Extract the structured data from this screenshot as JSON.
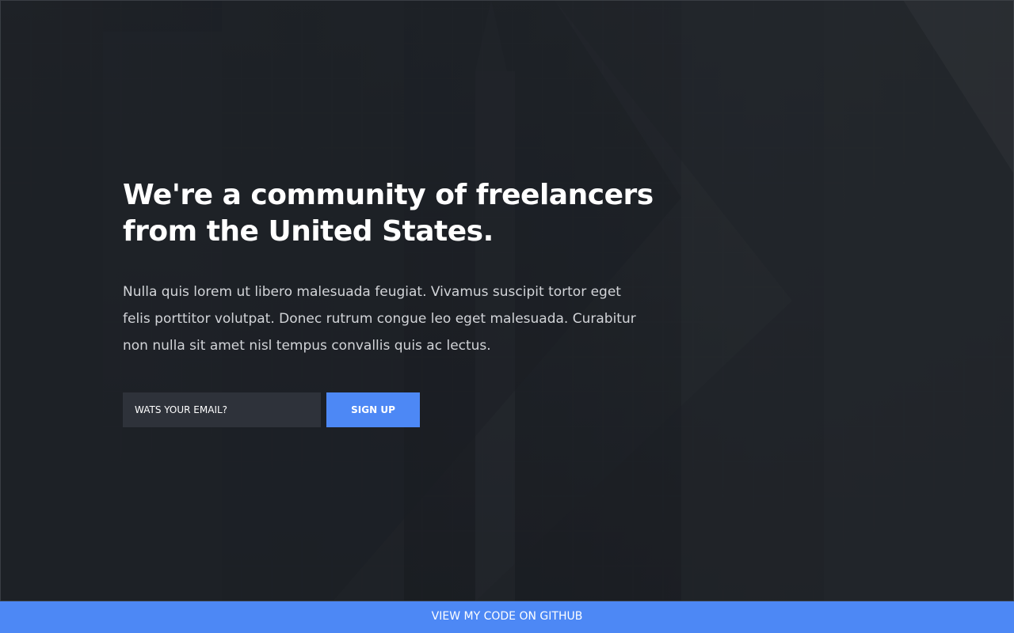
{
  "hero": {
    "headline_line1": "We're a community of freelancers",
    "headline_line2": "from the United States.",
    "description": "Nulla quis lorem ut libero malesuada feugiat. Vivamus suscipit tortor eget felis porttitor volutpat. Donec rutrum congue leo eget malesuada. Curabitur non nulla sit amet nisl tempus convallis quis ac lectus."
  },
  "signup_form": {
    "email_placeholder": "WATS YOUR EMAIL?",
    "email_value": "",
    "button_label": "SIGN UP"
  },
  "footer": {
    "github_link_label": "VIEW MY CODE ON GITHUB"
  },
  "colors": {
    "accent": "#4d88f5",
    "background": "#22262c",
    "input_background": "#2e323a"
  }
}
